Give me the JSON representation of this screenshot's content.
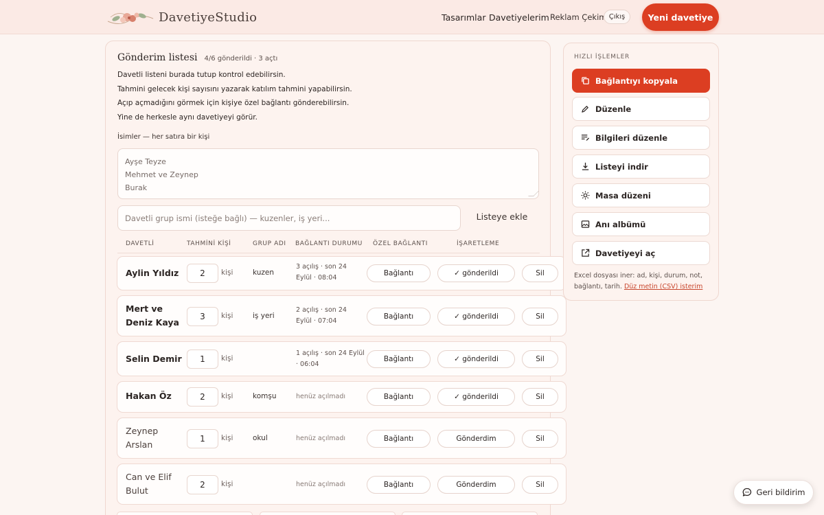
{
  "header": {
    "brand": "DavetiyeStudio",
    "nav": [
      "Tasarımlar",
      "Davetiyelerim",
      "Reklam Çekimi"
    ],
    "logout": "Çıkış",
    "new_invite": "Yeni davetiye"
  },
  "main": {
    "title": "Gönderim listesi",
    "meta": "4/6 gönderildi · 3 açtı",
    "description": [
      "Davetli listeni burada tutup kontrol edebilirsin.",
      "Tahmini gelecek kişi sayısını yazarak katılım tahmini yapabilirsin.",
      "Açıp açmadığını görmek için kişiye özel bağlantı gönderebilirsin.",
      "Yine de herkesle aynı davetiyeyi görür."
    ],
    "names_label": "İsimler — her satıra bir kişi",
    "names_lines": [
      "Ayşe Teyze",
      "Mehmet ve Zeynep",
      "Burak"
    ],
    "group_placeholder": "Davetli grup ismi (isteğe bağlı) — kuzenler, iş yeri...",
    "add_button": "Listeye ekle",
    "columns": [
      "DAVETLİ",
      "TAHMİNİ KİŞİ",
      "GRUP ADI",
      "BAĞLANTI DURUMU",
      "ÖZEL BAĞLANTI",
      "İŞARETLEME"
    ],
    "unit": "kişi",
    "link_label": "Bağlantı",
    "delete_label": "Sil",
    "rows": [
      {
        "name": "Aylin Yıldız",
        "count": "2",
        "group": "kuzen",
        "status": "3 açılış · son 24 Eylül · 08:04",
        "mark": "✓ gönderildi"
      },
      {
        "name": "Mert ve Deniz Kaya",
        "count": "3",
        "group": "iş yeri",
        "status": "2 açılış · son 24 Eylül · 07:04",
        "mark": "✓ gönderildi"
      },
      {
        "name": "Selin Demir",
        "count": "1",
        "group": "",
        "status": "1 açılış · son 24 Eylül · 06:04",
        "mark": "✓ gönderildi"
      },
      {
        "name": "Hakan Öz",
        "count": "2",
        "group": "komşu",
        "status": "henüz açılmadı",
        "mark": "✓ gönderildi"
      },
      {
        "name": "Zeynep Arslan",
        "count": "1",
        "group": "okul",
        "status": "henüz açılmadı",
        "mark": "Gönderdim"
      },
      {
        "name": "Can ve Elif Bulut",
        "count": "2",
        "group": "",
        "status": "henüz açılmadı",
        "mark": "Gönderdim"
      }
    ]
  },
  "sidebar": {
    "heading": "HIZLI İŞLEMLER",
    "actions": [
      {
        "label": "Bağlantıyı kopyala",
        "icon": "copy-icon"
      },
      {
        "label": "Düzenle",
        "icon": "pencil-icon"
      },
      {
        "label": "Bilgileri düzenle",
        "icon": "list-edit-icon"
      },
      {
        "label": "Listeyi indir",
        "icon": "download-icon"
      },
      {
        "label": "Masa düzeni",
        "icon": "sun-icon"
      },
      {
        "label": "Anı albümü",
        "icon": "image-icon"
      },
      {
        "label": "Davetiyeyi aç",
        "icon": "external-link-icon"
      }
    ],
    "note": "Excel dosyası iner: ad, kişi, durum, not, bağlantı, tarih.",
    "note_link": "Düz metin (CSV) isterim"
  },
  "feedback": "Geri bildirim",
  "colors": {
    "accent": "#dc3e22",
    "background": "#fcf5f2",
    "header": "#fbeae5"
  }
}
